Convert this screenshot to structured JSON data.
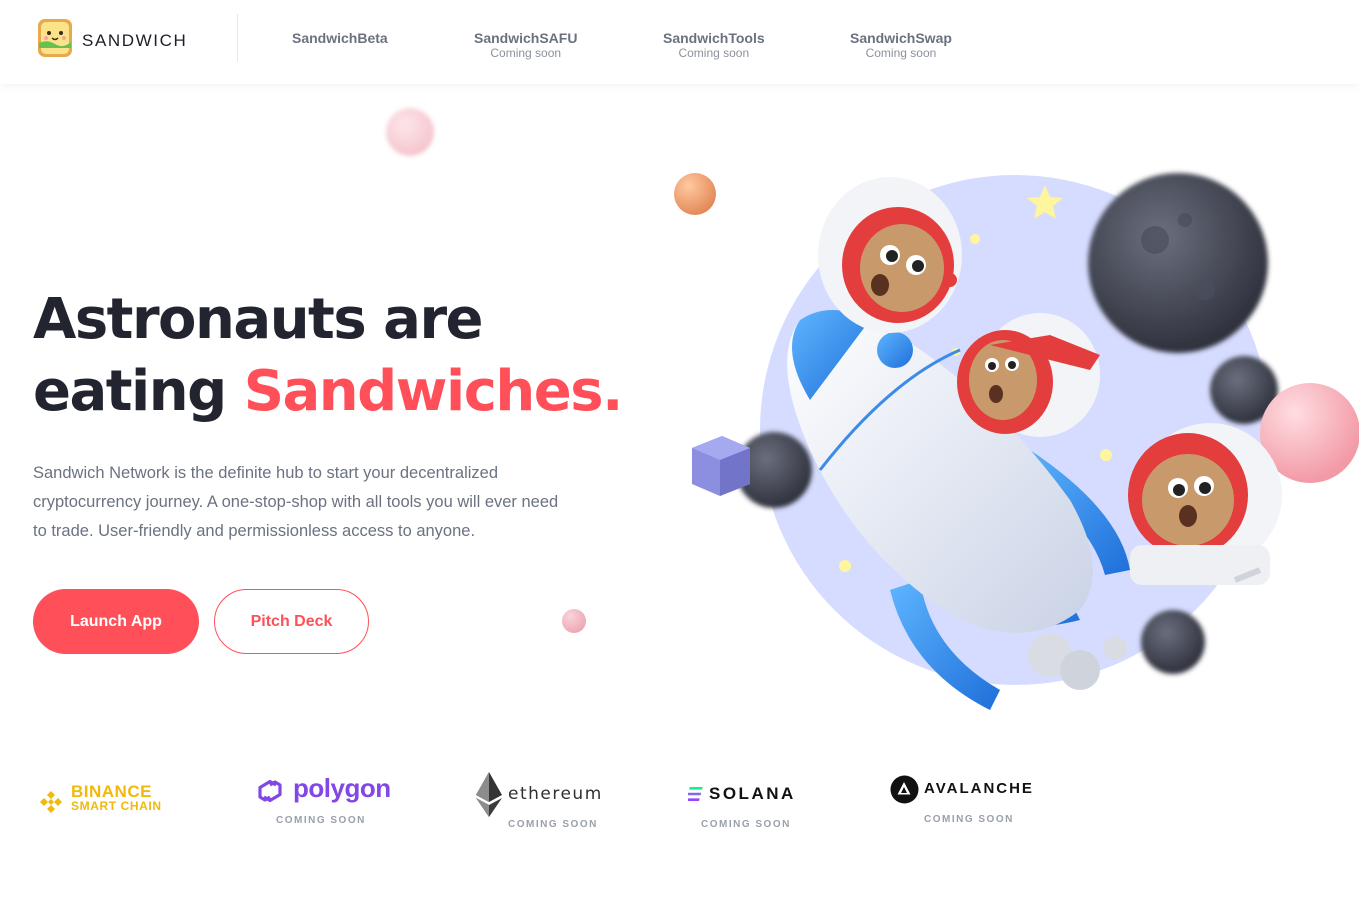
{
  "header": {
    "brand": "SANDWICH",
    "nav": [
      {
        "label": "SandwichBeta",
        "sub": ""
      },
      {
        "label": "SandwichSAFU",
        "sub": "Coming soon"
      },
      {
        "label": "SandwichTools",
        "sub": "Coming soon"
      },
      {
        "label": "SandwichSwap",
        "sub": "Coming soon"
      }
    ]
  },
  "hero": {
    "headline_line1": "Astronauts are",
    "headline_line2_plain": "eating ",
    "headline_line2_accent": "Sandwiches.",
    "description": "Sandwich Network is the definite hub to start your decentralized cryptocurrency journey. A one-stop-shop with all tools you will ever need to trade. User-friendly and permissionless access to anyone.",
    "primary_button": "Launch App",
    "secondary_button": "Pitch Deck"
  },
  "partners": {
    "binance": {
      "line1": "BINANCE",
      "line2": "SMART CHAIN"
    },
    "polygon": {
      "name": "polygon",
      "status": "COMING SOON"
    },
    "ethereum": {
      "name": "ethereum",
      "status": "COMING SOON"
    },
    "solana": {
      "name": "SOLANA",
      "status": "COMING SOON"
    },
    "avalanche": {
      "name": "AVALANCHE",
      "status": "COMING SOON"
    }
  },
  "colors": {
    "accent": "#ff5059",
    "text_dark": "#22252f",
    "text_muted": "#6b7280",
    "binance": "#f0b90b",
    "polygon": "#8247e5",
    "illustration_bg": "#d6dcff"
  },
  "icons": [
    "sandwich-logo-icon",
    "binance-icon",
    "polygon-icon",
    "ethereum-icon",
    "solana-icon",
    "avalanche-icon"
  ]
}
